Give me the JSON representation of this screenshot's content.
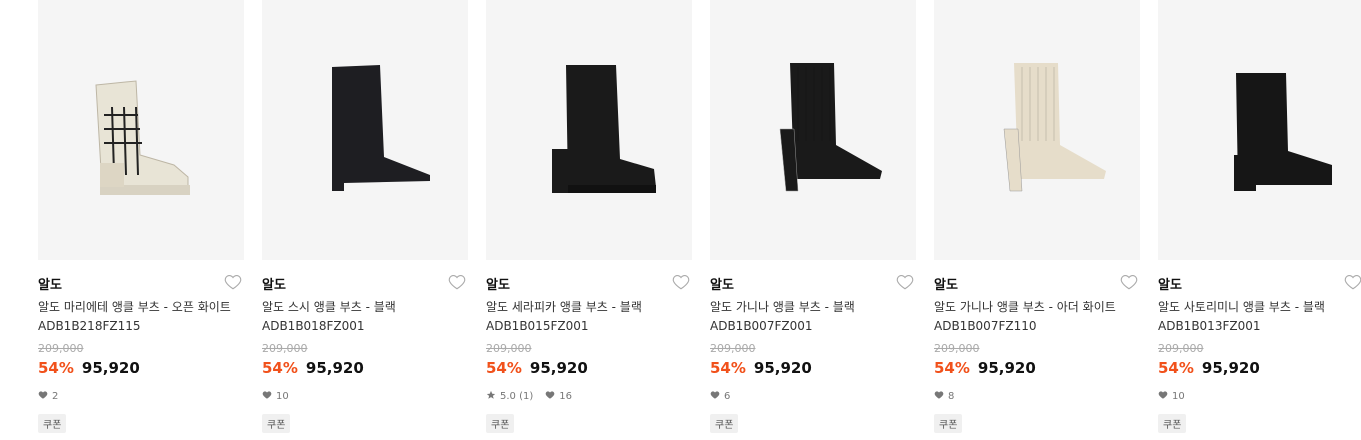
{
  "products": [
    {
      "brand": "알도",
      "title": "알도 마리에테 앵클 부츠 - 오픈 화이트 ADB1B218FZ115",
      "original_price": "209,000",
      "discount": "54%",
      "price": "95,920",
      "rating": "",
      "likes": "2",
      "coupon": "쿠폰",
      "boot": {
        "style": "hiker",
        "color": "#e8e4d6"
      }
    },
    {
      "brand": "알도",
      "title": "알도 스시 앵클 부츠 - 블랙 ADB1B018FZ001",
      "original_price": "209,000",
      "discount": "54%",
      "price": "95,920",
      "rating": "",
      "likes": "10",
      "coupon": "쿠폰",
      "boot": {
        "style": "stiletto",
        "color": "#1e1e22"
      }
    },
    {
      "brand": "알도",
      "title": "알도 세라피카 앵클 부츠 - 블랙 ADB1B015FZ001",
      "original_price": "209,000",
      "discount": "54%",
      "price": "95,920",
      "rating": "5.0 (1)",
      "likes": "16",
      "coupon": "쿠폰",
      "boot": {
        "style": "platform",
        "color": "#1a1a1a"
      }
    },
    {
      "brand": "알도",
      "title": "알도 가니나 앵클 부츠 - 블랙 ADB1B007FZ001",
      "original_price": "209,000",
      "discount": "54%",
      "price": "95,920",
      "rating": "",
      "likes": "6",
      "coupon": "쿠폰",
      "boot": {
        "style": "sock",
        "color": "#1a1a1a"
      }
    },
    {
      "brand": "알도",
      "title": "알도 가니나 앵클 부츠 - 아더 화이트 ADB1B007FZ110",
      "original_price": "209,000",
      "discount": "54%",
      "price": "95,920",
      "rating": "",
      "likes": "8",
      "coupon": "쿠폰",
      "boot": {
        "style": "sock",
        "color": "#e6ddca"
      }
    },
    {
      "brand": "알도",
      "title": "알도 사토리미니 앵클 부츠 - 블랙 ADB1B013FZ001",
      "original_price": "209,000",
      "discount": "54%",
      "price": "95,920",
      "rating": "",
      "likes": "10",
      "coupon": "쿠폰",
      "boot": {
        "style": "block",
        "color": "#161616"
      }
    }
  ],
  "colors": {
    "discount": "#f1511b",
    "thumb_bg": "#f5f5f5"
  },
  "icons": {
    "favorite": "heart-outline-icon",
    "likes": "heart-filled-icon",
    "rating": "star-icon"
  }
}
